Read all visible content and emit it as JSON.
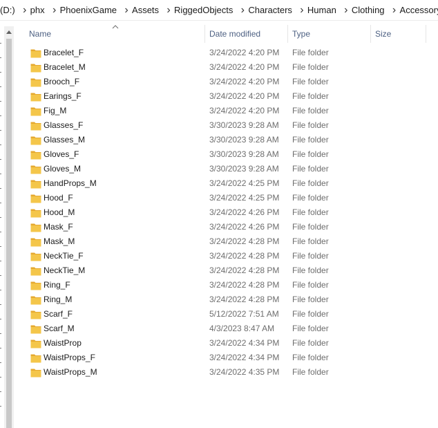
{
  "breadcrumb": [
    "(D:)",
    "phx",
    "PhoenixGame",
    "Assets",
    "RiggedObjects",
    "Characters",
    "Human",
    "Clothing",
    "Accessory"
  ],
  "columns": {
    "name": "Name",
    "date": "Date modified",
    "type": "Type",
    "size": "Size"
  },
  "colors": {
    "header_text": "#4d6082",
    "folder": "#f4c64a",
    "folder_dark": "#e5a92f",
    "meta_text": "#6d6d6d"
  },
  "files": [
    {
      "name": "Bracelet_F",
      "date": "3/24/2022 4:20 PM",
      "type": "File folder"
    },
    {
      "name": "Bracelet_M",
      "date": "3/24/2022 4:20 PM",
      "type": "File folder"
    },
    {
      "name": "Brooch_F",
      "date": "3/24/2022 4:20 PM",
      "type": "File folder"
    },
    {
      "name": "Earings_F",
      "date": "3/24/2022 4:20 PM",
      "type": "File folder"
    },
    {
      "name": "Fig_M",
      "date": "3/24/2022 4:20 PM",
      "type": "File folder"
    },
    {
      "name": "Glasses_F",
      "date": "3/30/2023 9:28 AM",
      "type": "File folder"
    },
    {
      "name": "Glasses_M",
      "date": "3/30/2023 9:28 AM",
      "type": "File folder"
    },
    {
      "name": "Gloves_F",
      "date": "3/30/2023 9:28 AM",
      "type": "File folder"
    },
    {
      "name": "Gloves_M",
      "date": "3/30/2023 9:28 AM",
      "type": "File folder"
    },
    {
      "name": "HandProps_M",
      "date": "3/24/2022 4:25 PM",
      "type": "File folder"
    },
    {
      "name": "Hood_F",
      "date": "3/24/2022 4:25 PM",
      "type": "File folder"
    },
    {
      "name": "Hood_M",
      "date": "3/24/2022 4:26 PM",
      "type": "File folder"
    },
    {
      "name": "Mask_F",
      "date": "3/24/2022 4:26 PM",
      "type": "File folder"
    },
    {
      "name": "Mask_M",
      "date": "3/24/2022 4:28 PM",
      "type": "File folder"
    },
    {
      "name": "NeckTie_F",
      "date": "3/24/2022 4:28 PM",
      "type": "File folder"
    },
    {
      "name": "NeckTie_M",
      "date": "3/24/2022 4:28 PM",
      "type": "File folder"
    },
    {
      "name": "Ring_F",
      "date": "3/24/2022 4:28 PM",
      "type": "File folder"
    },
    {
      "name": "Ring_M",
      "date": "3/24/2022 4:28 PM",
      "type": "File folder"
    },
    {
      "name": "Scarf_F",
      "date": "5/12/2022 7:51 AM",
      "type": "File folder"
    },
    {
      "name": "Scarf_M",
      "date": "4/3/2023 8:47 AM",
      "type": "File folder"
    },
    {
      "name": "WaistProp",
      "date": "3/24/2022 4:34 PM",
      "type": "File folder"
    },
    {
      "name": "WaistProps_F",
      "date": "3/24/2022 4:34 PM",
      "type": "File folder"
    },
    {
      "name": "WaistProps_M",
      "date": "3/24/2022 4:35 PM",
      "type": "File folder"
    }
  ]
}
